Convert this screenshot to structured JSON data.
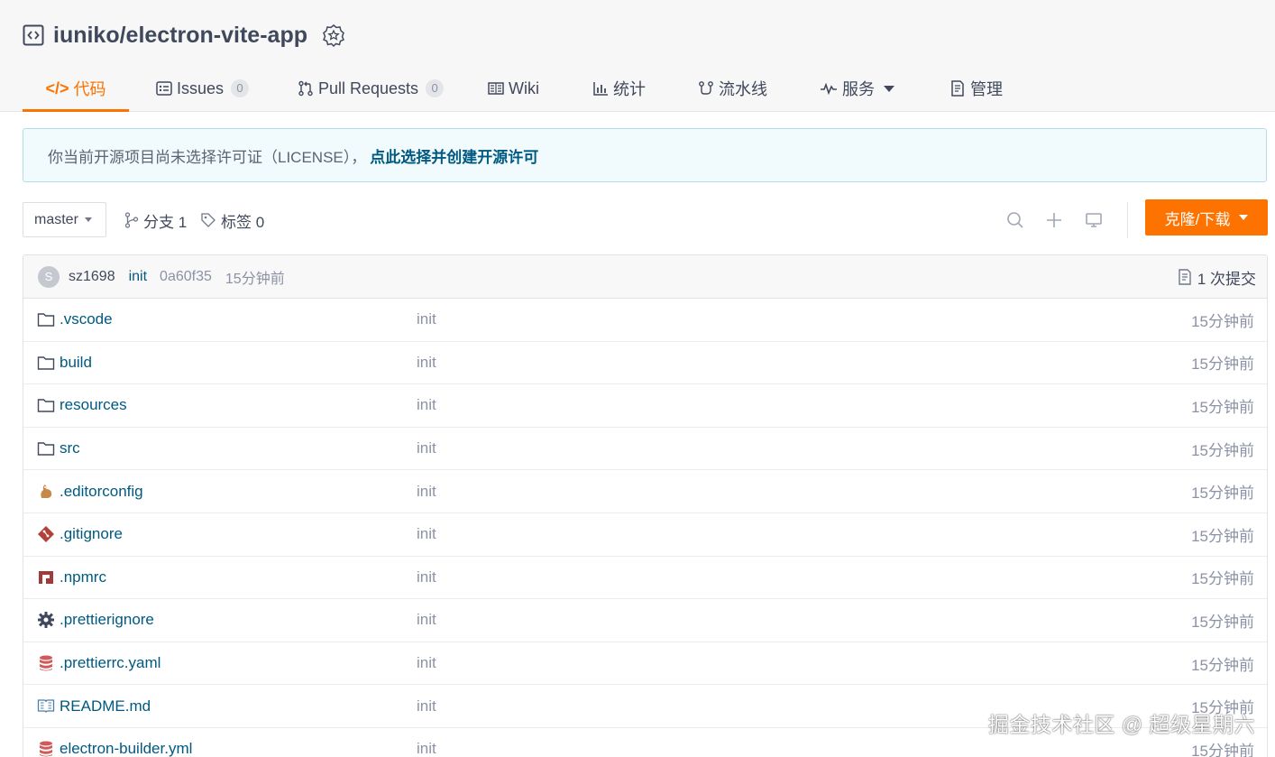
{
  "repo": {
    "name": "iuniko/electron-vite-app"
  },
  "tabs": [
    {
      "label": "代码",
      "icon": "code-icon",
      "active": true
    },
    {
      "label": "Issues",
      "icon": "issues-icon",
      "count": "0"
    },
    {
      "label": "Pull Requests",
      "icon": "pull-request-icon",
      "count": "0"
    },
    {
      "label": "Wiki",
      "icon": "book-icon"
    },
    {
      "label": "统计",
      "icon": "bar-chart-icon"
    },
    {
      "label": "流水线",
      "icon": "pipeline-icon"
    },
    {
      "label": "服务",
      "icon": "pulse-icon"
    },
    {
      "label": "管理",
      "icon": "settings-doc-icon"
    }
  ],
  "notice": {
    "text": "你当前开源项目尚未选择许可证（LICENSE），",
    "link": "点此选择并创建开源许可"
  },
  "toolbar": {
    "branch": "master",
    "branches": "分支 1",
    "tags": "标签 0",
    "clone_label": "克隆/下载"
  },
  "commit": {
    "avatar_letter": "S",
    "author": "sz1698",
    "message": "init",
    "sha": "0a60f35",
    "time": "15分钟前",
    "count_label": "1 次提交"
  },
  "files": [
    {
      "name": ".vscode",
      "type": "folder",
      "message": "init",
      "time": "15分钟前"
    },
    {
      "name": "build",
      "type": "folder",
      "message": "init",
      "time": "15分钟前"
    },
    {
      "name": "resources",
      "type": "folder",
      "message": "init",
      "time": "15分钟前"
    },
    {
      "name": "src",
      "type": "folder",
      "message": "init",
      "time": "15分钟前"
    },
    {
      "name": ".editorconfig",
      "type": "editorconfig",
      "message": "init",
      "time": "15分钟前"
    },
    {
      "name": ".gitignore",
      "type": "git",
      "message": "init",
      "time": "15分钟前"
    },
    {
      "name": ".npmrc",
      "type": "npm",
      "message": "init",
      "time": "15分钟前"
    },
    {
      "name": ".prettierignore",
      "type": "gear",
      "message": "init",
      "time": "15分钟前"
    },
    {
      "name": ".prettierrc.yaml",
      "type": "database",
      "message": "init",
      "time": "15分钟前"
    },
    {
      "name": "README.md",
      "type": "readme",
      "message": "init",
      "time": "15分钟前"
    },
    {
      "name": "electron-builder.yml",
      "type": "database",
      "message": "init",
      "time": "15分钟前"
    }
  ],
  "watermark": "掘金技术社区 @ 超级星期六",
  "colors": {
    "accent": "#fe7300",
    "link": "#005980",
    "text": "#40485b",
    "muted": "#8c92a4"
  }
}
